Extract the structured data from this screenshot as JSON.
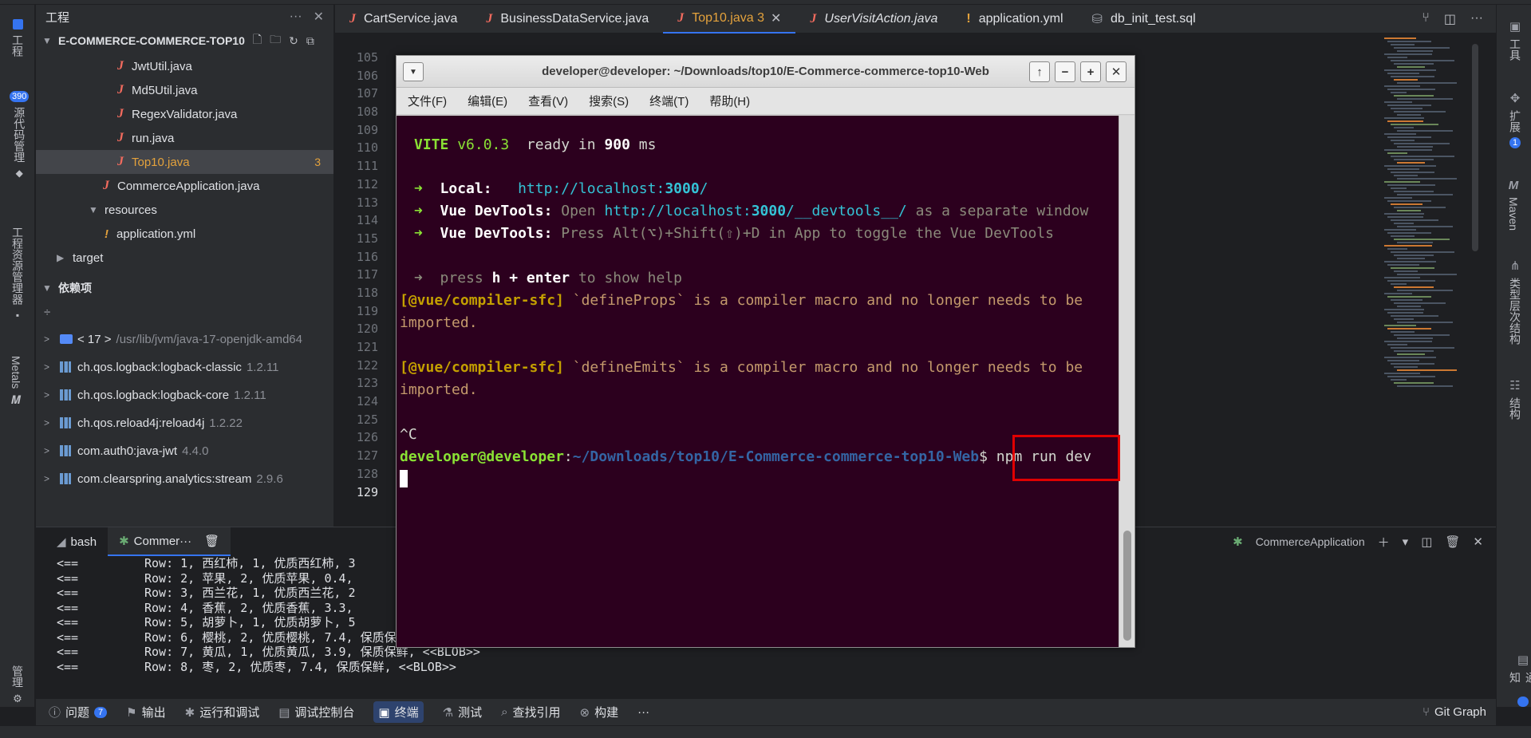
{
  "left_bar": {
    "project_label": "工程",
    "commit_label": "源代码管理",
    "commit_count": "390",
    "explorer_label": "工程资源管理器",
    "metals_label": "Metals",
    "manage_label": "管理"
  },
  "right_bar": {
    "tools_label": "工具",
    "extensions_label": "扩展",
    "extensions_count": "1",
    "maven_label": "Maven",
    "hierarchy_label": "类型层次结构",
    "structure_label": "结构",
    "notify_label": "通知"
  },
  "project": {
    "title": "工程",
    "root": "E-COMMERCE-COMMERCE-TOP10",
    "files": [
      {
        "name": "JwtUtil.java",
        "type": "java"
      },
      {
        "name": "Md5Util.java",
        "type": "java"
      },
      {
        "name": "RegexValidator.java",
        "type": "java"
      },
      {
        "name": "run.java",
        "type": "java"
      },
      {
        "name": "Top10.java",
        "type": "java",
        "problems": "3"
      }
    ],
    "commerce_app": "CommerceApplication.java",
    "resources": "resources",
    "application_yml": "application.yml",
    "target": "target",
    "deps_header": "依赖项",
    "jdk": {
      "name": "< 17 >",
      "path": "/usr/lib/jvm/java-17-openjdk-amd64"
    },
    "deps": [
      {
        "name": "ch.qos.logback:logback-classic",
        "version": "1.2.11"
      },
      {
        "name": "ch.qos.logback:logback-core",
        "version": "1.2.11"
      },
      {
        "name": "ch.qos.reload4j:reload4j",
        "version": "1.2.22"
      },
      {
        "name": "com.auth0:java-jwt",
        "version": "4.4.0"
      },
      {
        "name": "com.clearspring.analytics:stream",
        "version": "2.9.6"
      }
    ]
  },
  "tabs": [
    {
      "label": "CartService.java",
      "icon": "J"
    },
    {
      "label": "BusinessDataService.java",
      "icon": "J"
    },
    {
      "label": "Top10.java 3",
      "icon": "J",
      "active": true
    },
    {
      "label": "UserVisitAction.java",
      "icon": "J",
      "italic": true
    },
    {
      "label": "application.yml",
      "icon": "!"
    },
    {
      "label": "db_init_test.sql",
      "icon": "db"
    }
  ],
  "editor": {
    "line_numbers": [
      "105",
      "106",
      "107",
      "108",
      "109",
      "110",
      "111",
      "112",
      "113",
      "114",
      "115",
      "116",
      "117",
      "118",
      "119",
      "120",
      "121",
      "122",
      "123",
      "124",
      "125",
      "126",
      "127",
      "128",
      "129"
    ]
  },
  "bottom_panel": {
    "tab_bash": "bash",
    "tab_commerce": "Commer···",
    "run_config": "CommerceApplication",
    "rows": [
      {
        "arrow": "<==",
        "text": "Row: 1, 西红柿, 1, 优质西红柿, 3"
      },
      {
        "arrow": "<==",
        "text": "Row: 2, 苹果, 2, 优质苹果, 0.4,"
      },
      {
        "arrow": "<==",
        "text": "Row: 3, 西兰花, 1, 优质西兰花, 2"
      },
      {
        "arrow": "<==",
        "text": "Row: 4, 香蕉, 2, 优质香蕉, 3.3,"
      },
      {
        "arrow": "<==",
        "text": "Row: 5, 胡萝卜, 1, 优质胡萝卜, 5"
      },
      {
        "arrow": "<==",
        "text": "Row: 6, 樱桃, 2, 优质樱桃, 7.4, 保质保鲜, <<BLOB>>"
      },
      {
        "arrow": "<==",
        "text": "Row: 7, 黄瓜, 1, 优质黄瓜, 3.9, 保质保鲜, <<BLOB>>"
      },
      {
        "arrow": "<==",
        "text": "Row: 8, 枣, 2, 优质枣, 7.4, 保质保鲜, <<BLOB>>"
      }
    ]
  },
  "bottom_tools": {
    "problems": "问题",
    "problems_count": "7",
    "output": "输出",
    "run_debug": "运行和调试",
    "debug_console": "调试控制台",
    "terminal": "终端",
    "test": "测试",
    "find_refs": "查找引用",
    "build": "构建",
    "more": "···",
    "git_graph": "Git Graph"
  },
  "terminal_window": {
    "title": "developer@developer: ~/Downloads/top10/E-Commerce-commerce-top10-Web",
    "menu": [
      "文件(F)",
      "编辑(E)",
      "查看(V)",
      "搜索(S)",
      "终端(T)",
      "帮助(H)"
    ],
    "vite_name": "VITE",
    "vite_version": " v6.0.3",
    "ready_text": "  ready in ",
    "ready_ms": "900",
    "ready_unit": " ms",
    "local_label": "Local:",
    "local_url_a": "http://localhost:",
    "local_url_port": "3000",
    "local_url_b": "/",
    "devtools_label": "Vue DevTools:",
    "devtools_open_a": " Open ",
    "devtools_open_url_a": "http://localhost:",
    "devtools_open_port": "3000",
    "devtools_open_url_b": "/__devtools__/",
    "devtools_open_b": " as a separate window",
    "devtools_press": " Press Alt(⌥)+Shift(⇧)+D in App to toggle the Vue DevTools",
    "help_press": "press ",
    "help_key": "h + enter",
    "help_rest": " to show help",
    "warn_tag": "[@vue/compiler-sfc]",
    "warn1_a": " `defineProps` is a compiler macro and no longer needs to be",
    "warn1_b": "imported.",
    "warn2_a": " `defineEmits` is a compiler macro and no longer needs to be",
    "warn2_b": "imported.",
    "ctrl_c": "^C",
    "prompt_user": "developer@developer",
    "prompt_sep": ":",
    "prompt_path": "~/Downloads/top10/E-Commerce-commerce-top10-Web",
    "prompt_dollar": "$",
    "command": " npm run dev",
    "arrow": "➜"
  }
}
